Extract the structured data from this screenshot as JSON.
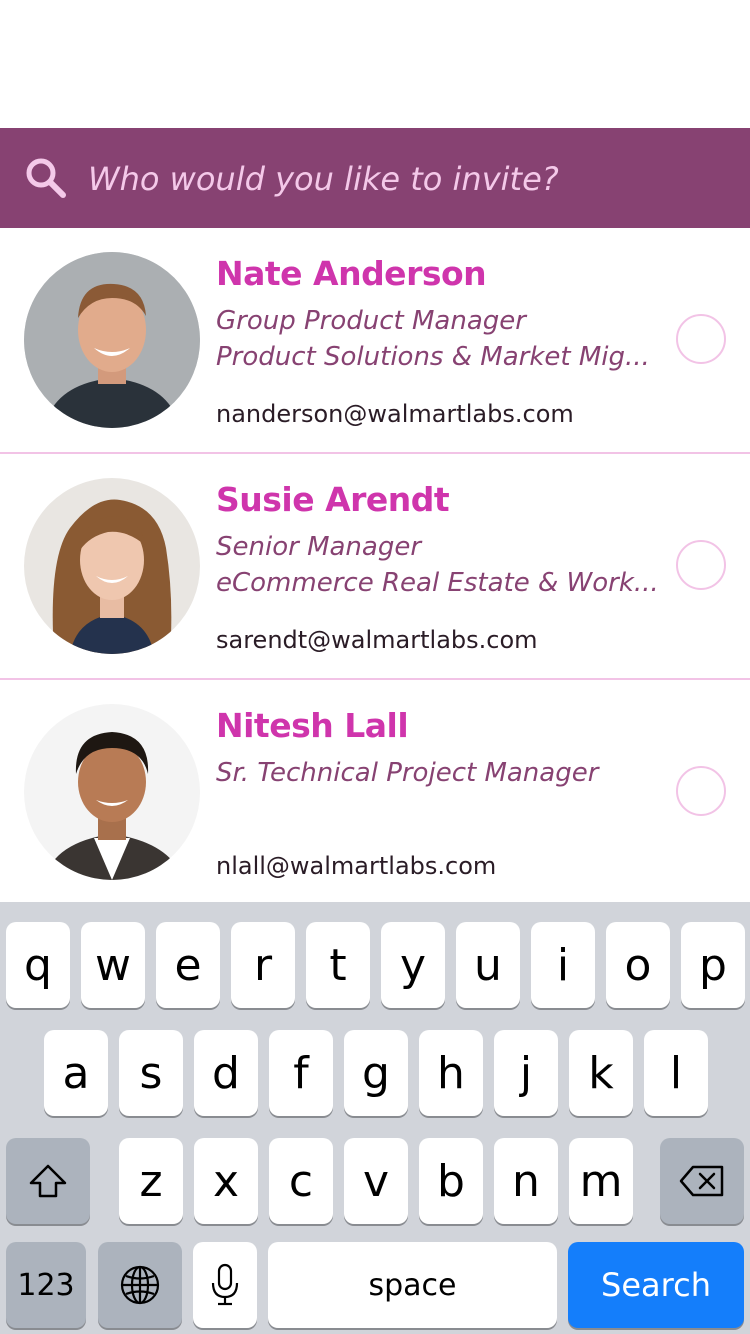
{
  "search": {
    "placeholder": "Who would you like to invite?",
    "value": ""
  },
  "contacts": [
    {
      "name": "Nate Anderson",
      "title": "Group Product Manager",
      "department": "Product Solutions & Market Mig...",
      "email": "nanderson@walmartlabs.com",
      "selected": false
    },
    {
      "name": "Susie Arendt",
      "title": "Senior Manager",
      "department": "eCommerce Real Estate & Work...",
      "email": "sarendt@walmartlabs.com",
      "selected": false
    },
    {
      "name": "Nitesh Lall",
      "title": "Sr. Technical Project Manager",
      "department": "",
      "email": "nlall@walmartlabs.com",
      "selected": false
    }
  ],
  "keyboard": {
    "row1": [
      "q",
      "w",
      "e",
      "r",
      "t",
      "y",
      "u",
      "i",
      "o",
      "p"
    ],
    "row2": [
      "a",
      "s",
      "d",
      "f",
      "g",
      "h",
      "j",
      "k",
      "l"
    ],
    "row3": [
      "z",
      "x",
      "c",
      "v",
      "b",
      "n",
      "m"
    ],
    "numbers_label": "123",
    "space_label": "space",
    "search_label": "Search",
    "icons": [
      "shift-icon",
      "delete-icon",
      "globe-icon",
      "microphone-icon"
    ]
  },
  "colors": {
    "header": "#874272",
    "placeholder": "#f4c9e9",
    "name": "#cf35ac",
    "title": "#874272",
    "divider": "#f2c3e6",
    "keyboard_bg": "#d1d4da",
    "search_key": "#147efb"
  }
}
